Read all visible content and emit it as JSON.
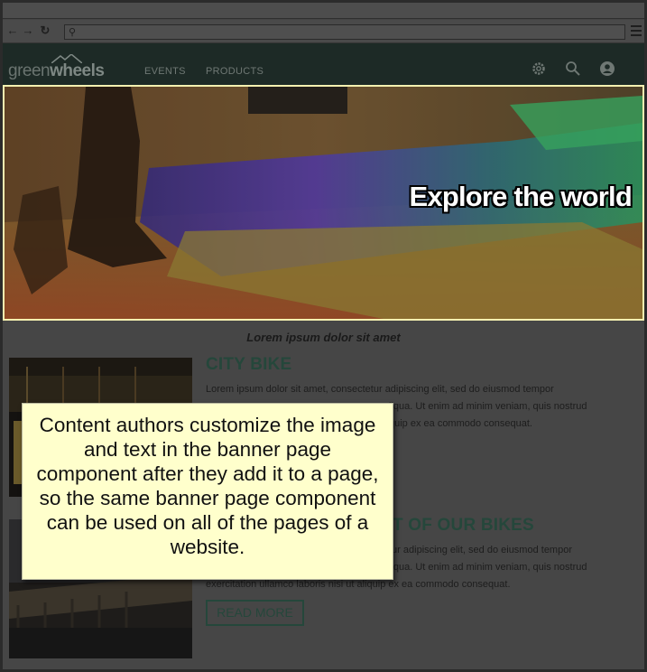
{
  "browser": {
    "back_icon": "back-arrow-icon",
    "forward_icon": "forward-arrow-icon",
    "reload_icon": "reload-icon",
    "search_icon": "search-icon",
    "url": "",
    "menu_icon": "hamburger-menu-icon"
  },
  "site": {
    "logo": {
      "light": "green",
      "bold": "wheels"
    },
    "nav": [
      {
        "label": "EVENTS"
      },
      {
        "label": "PRODUCTS"
      }
    ],
    "header_icons": [
      "gear-icon",
      "search-icon",
      "user-icon"
    ]
  },
  "banner": {
    "title": "Explore the world"
  },
  "main": {
    "caption": "Lorem ipsum dolor sit amet",
    "articles": [
      {
        "title": "CITY BIKE",
        "text_lines": [
          "Lorem ipsum dolor sit amet, consectetur adipiscing elit, sed do eiusmod tempor",
          "liqua. Ut enim ad minim veniam, quis nostrud",
          "quip ex ea commodo consequat."
        ]
      },
      {
        "title": "T OF OUR BIKES",
        "text_lines": [
          "tur adipiscing elit, sed do eiusmod tempor",
          "liqua. Ut enim ad minim veniam, quis nostrud",
          "exercitation ullamco laboris nisi ut aliquip ex ea commodo consequat."
        ],
        "button": "READ MORE"
      }
    ]
  },
  "callout": {
    "text": "Content authors customize the image and text in the banner page component after they add it to a page, so the same banner page component can be used on all of the pages of a website."
  },
  "colors": {
    "header_bg": "#1d2a26",
    "accent_green": "#25473b",
    "banner_border": "#f4f0b0",
    "callout_bg": "#ffffcc"
  }
}
